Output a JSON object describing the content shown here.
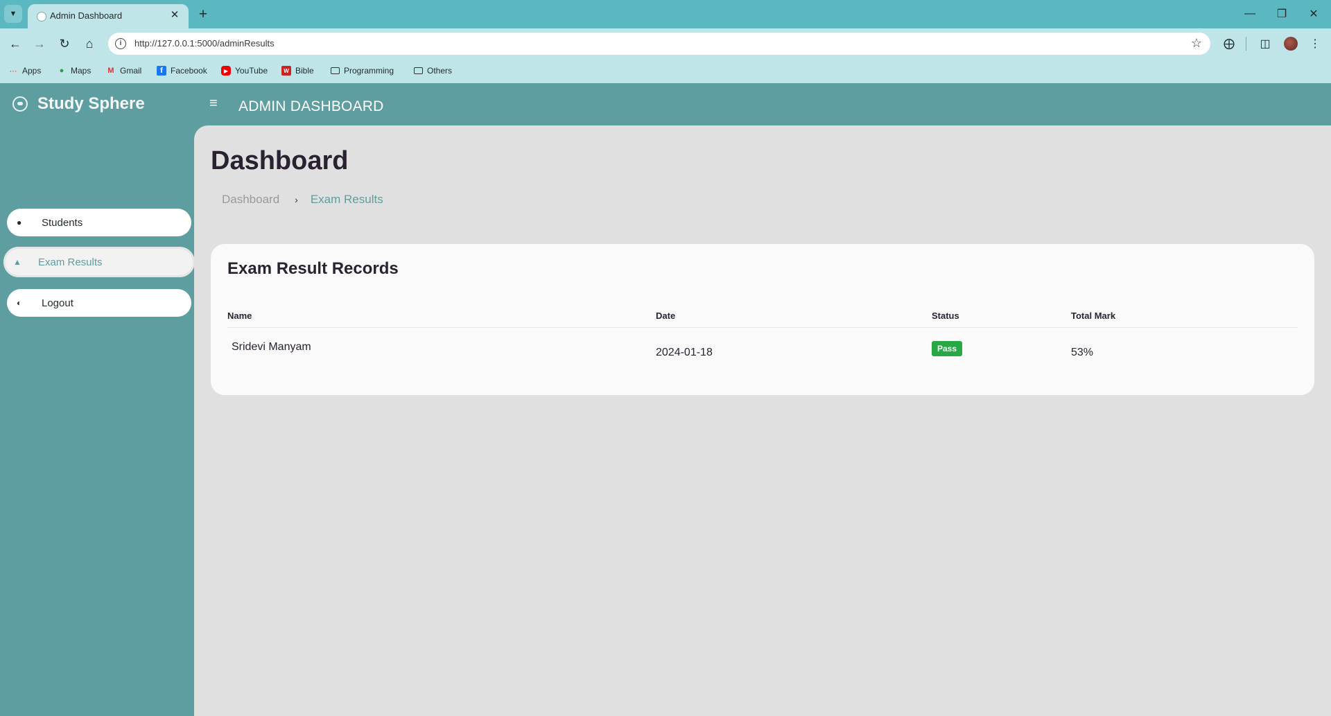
{
  "browser": {
    "tab_title": "Admin Dashboard",
    "url": "http://127.0.0.1:5000/adminResults",
    "bookmarks": [
      {
        "label": "Apps",
        "icon": "apps-grid-icon"
      },
      {
        "label": "Maps",
        "icon": "maps-pin-icon"
      },
      {
        "label": "Gmail",
        "icon": "gmail-icon"
      },
      {
        "label": "Facebook",
        "icon": "facebook-icon"
      },
      {
        "label": "YouTube",
        "icon": "youtube-icon"
      },
      {
        "label": "Bible",
        "icon": "bible-icon"
      },
      {
        "label": "Programming",
        "icon": "folder-icon"
      },
      {
        "label": "Others",
        "icon": "folder-icon"
      }
    ]
  },
  "app": {
    "brand": "Study Sphere",
    "header_title": "ADMIN DASHBOARD"
  },
  "sidebar": {
    "items": [
      {
        "label": "Students",
        "icon": "users-icon",
        "active": false
      },
      {
        "label": "Exam Results",
        "icon": "graduation-cap-icon",
        "active": true
      },
      {
        "label": "Logout",
        "icon": "logout-icon",
        "active": false
      }
    ]
  },
  "main": {
    "page_title": "Dashboard",
    "breadcrumb": {
      "home": "Dashboard",
      "current": "Exam Results"
    },
    "card": {
      "title": "Exam Result Records",
      "columns": [
        "Name",
        "Date",
        "Status",
        "Total Mark"
      ],
      "rows": [
        {
          "name": "Sridevi Manyam",
          "date": "2024-01-18",
          "status": "Pass",
          "total": "53%"
        }
      ]
    }
  },
  "colors": {
    "accent": "#5f9ea0",
    "browser_frame": "#5bb8c1",
    "pass_badge": "#28a745"
  }
}
